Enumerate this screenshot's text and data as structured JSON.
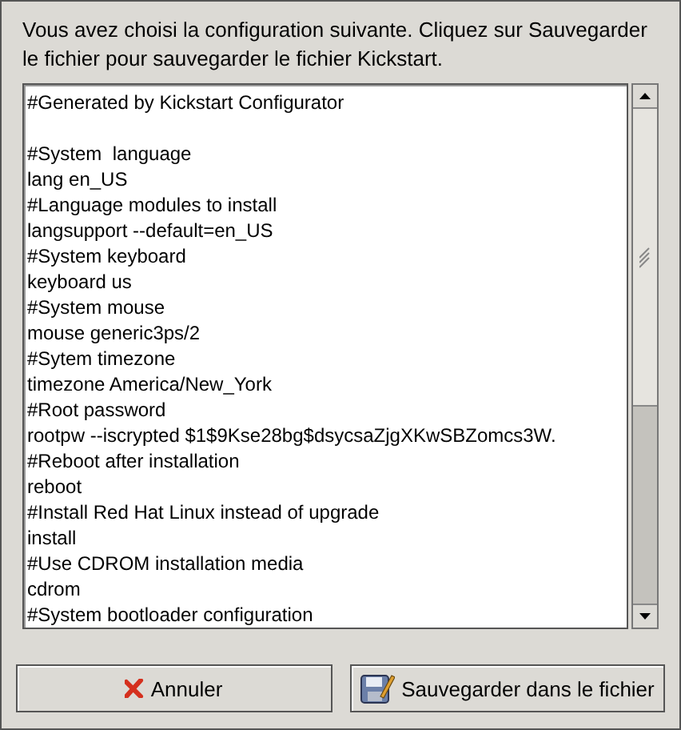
{
  "message": "Vous avez choisi la configuration suivante. Cliquez sur Sauvegarder le fichier pour sauvegarder le fichier Kickstart.",
  "config_sections": [
    [
      "#Generated by Kickstart Configurator"
    ],
    [
      "#System  language",
      "lang en_US",
      "#Language modules to install",
      "langsupport --default=en_US",
      "#System keyboard",
      "keyboard us",
      "#System mouse",
      "mouse generic3ps/2",
      "#Sytem timezone",
      "timezone America/New_York",
      "#Root password",
      "rootpw --iscrypted $1$9Kse28bg$dsycsaZjgXKwSBZomcs3W.",
      "#Reboot after installation",
      "reboot",
      "#Install Red Hat Linux instead of upgrade",
      "install",
      "#Use CDROM installation media",
      "cdrom",
      "#System bootloader configuration"
    ]
  ],
  "buttons": [
    {
      "kind": "cancel",
      "label": "Annuler"
    },
    {
      "kind": "save",
      "label": "Sauvegarder dans le fichier"
    }
  ]
}
